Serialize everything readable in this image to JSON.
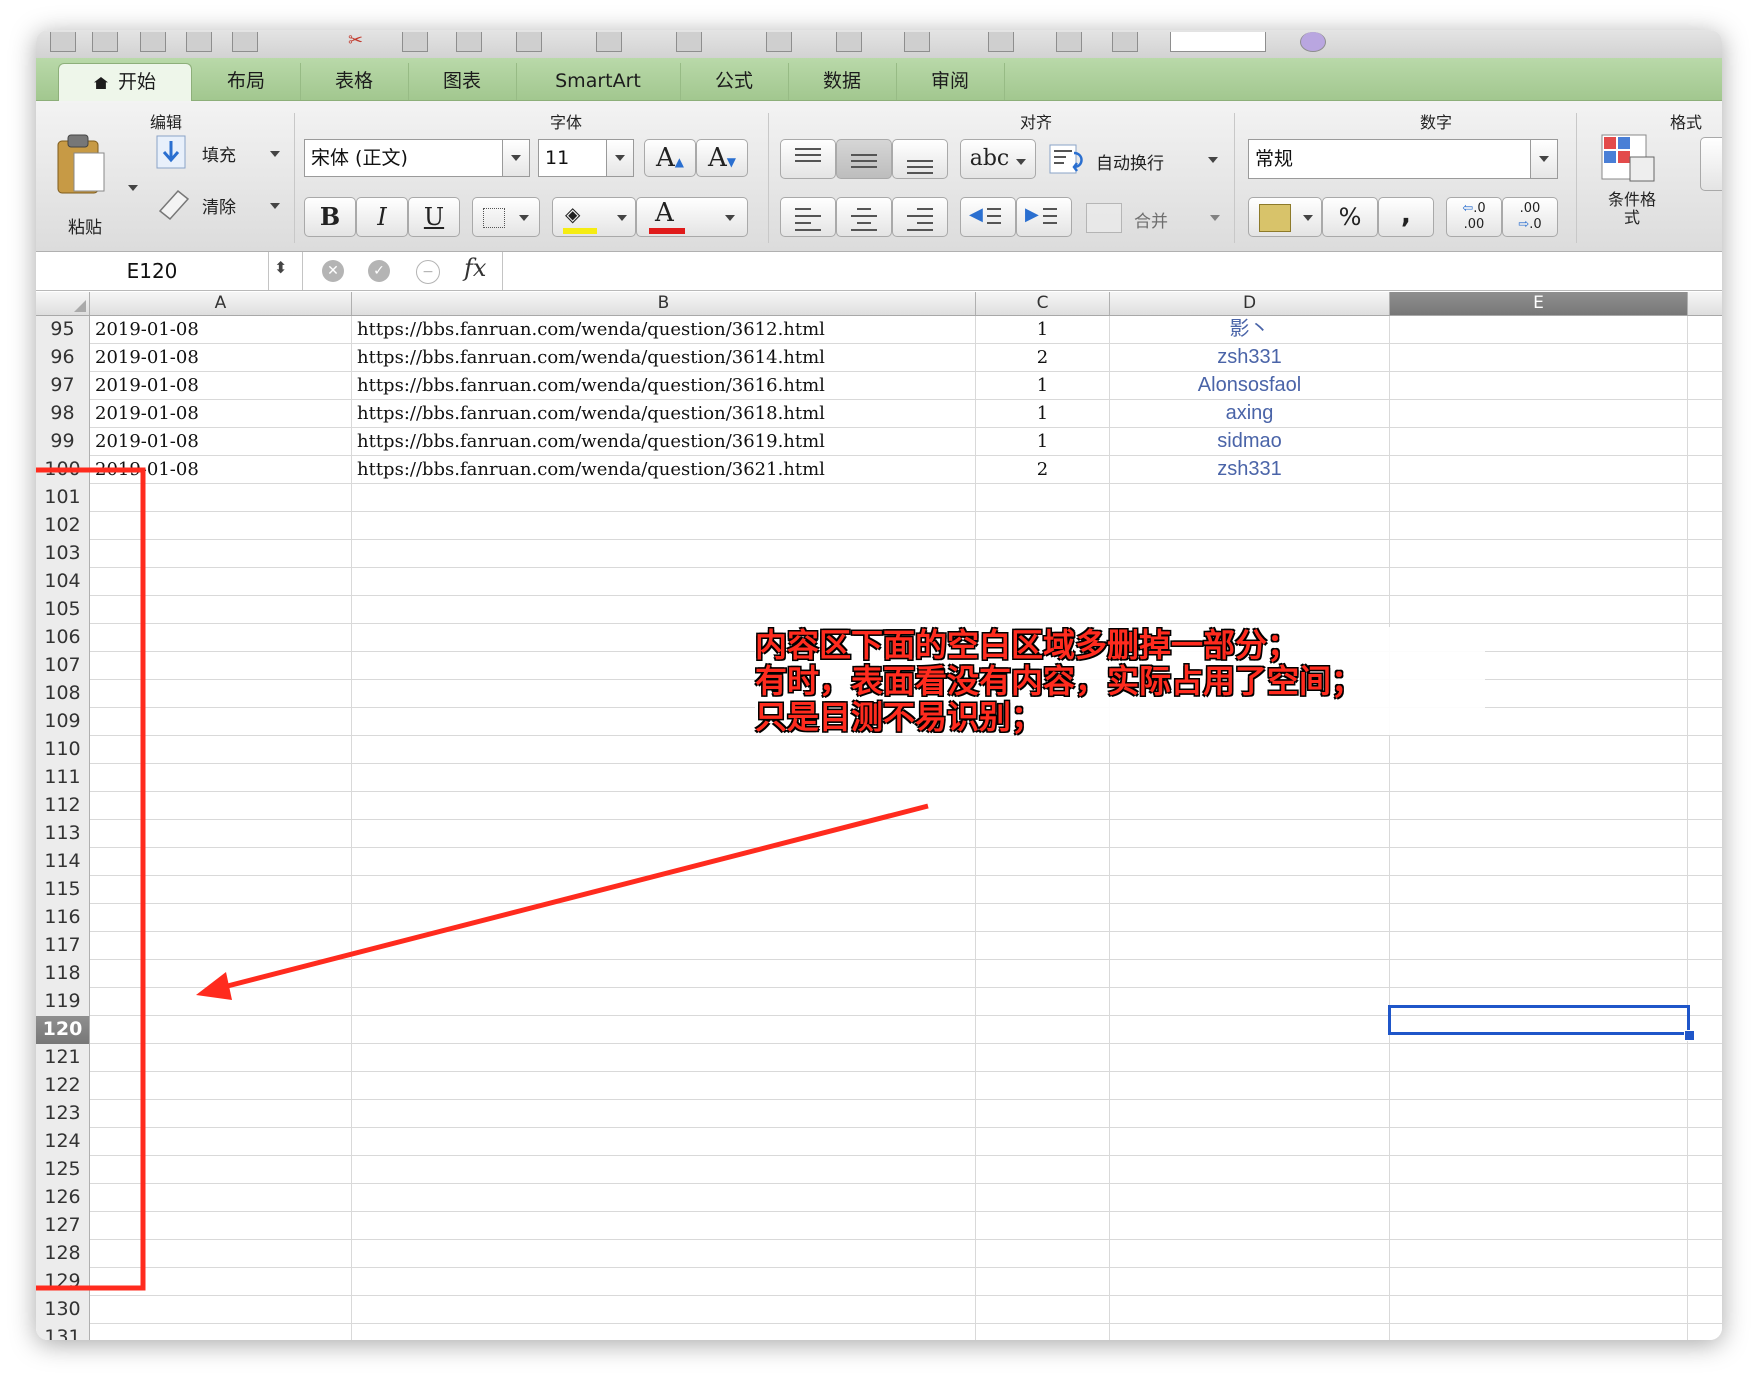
{
  "ribbon_tabs": [
    {
      "label": "开始",
      "active": true
    },
    {
      "label": "布局"
    },
    {
      "label": "表格"
    },
    {
      "label": "图表"
    },
    {
      "label": "SmartArt"
    },
    {
      "label": "公式"
    },
    {
      "label": "数据"
    },
    {
      "label": "审阅"
    }
  ],
  "groups": {
    "edit": "编辑",
    "font": "字体",
    "align": "对齐",
    "number": "数字",
    "format": "格式"
  },
  "edit": {
    "paste": "粘贴",
    "fill": "填充",
    "clear": "清除"
  },
  "font": {
    "name": "宋体 (正文)",
    "size": "11",
    "bold": "B",
    "italic": "I",
    "underline": "U",
    "color_letter": "A"
  },
  "align": {
    "orient": "abc",
    "wrap": "自动换行",
    "merge": "合并"
  },
  "number": {
    "format": "常规",
    "percent": "%",
    "comma": ","
  },
  "format": {
    "cond": "条件格式"
  },
  "formula": {
    "name_box": "E120",
    "fx": "fx"
  },
  "columns": [
    "A",
    "B",
    "C",
    "D",
    "E"
  ],
  "selected_column": "E",
  "rows": [
    {
      "num": "95",
      "a": "2019-01-08",
      "b": "https://bbs.fanruan.com/wenda/question/3612.html",
      "c": "1",
      "d": "影丶"
    },
    {
      "num": "96",
      "a": "2019-01-08",
      "b": "https://bbs.fanruan.com/wenda/question/3614.html",
      "c": "2",
      "d": "zsh331"
    },
    {
      "num": "97",
      "a": "2019-01-08",
      "b": "https://bbs.fanruan.com/wenda/question/3616.html",
      "c": "1",
      "d": "Alonsosfaol"
    },
    {
      "num": "98",
      "a": "2019-01-08",
      "b": "https://bbs.fanruan.com/wenda/question/3618.html",
      "c": "1",
      "d": "axing"
    },
    {
      "num": "99",
      "a": "2019-01-08",
      "b": "https://bbs.fanruan.com/wenda/question/3619.html",
      "c": "1",
      "d": "sidmao"
    },
    {
      "num": "100",
      "a": "2019-01-08",
      "b": "https://bbs.fanruan.com/wenda/question/3621.html",
      "c": "2",
      "d": "zsh331"
    }
  ],
  "empty_rows": [
    "101",
    "102",
    "103",
    "104",
    "105",
    "106",
    "107",
    "108",
    "109",
    "110",
    "111",
    "112",
    "113",
    "114",
    "115",
    "116",
    "117",
    "118",
    "119",
    "120",
    "121",
    "122",
    "123",
    "124",
    "125",
    "126",
    "127",
    "128",
    "129",
    "130",
    "131"
  ],
  "selected_row": "120",
  "annotation": {
    "lines": [
      "内容区下面的空白区域多删掉一部分；",
      "有时，表面看没有内容，实际占用了空间；",
      "只是目测不易识别；"
    ],
    "color": "#ff2b1e"
  }
}
